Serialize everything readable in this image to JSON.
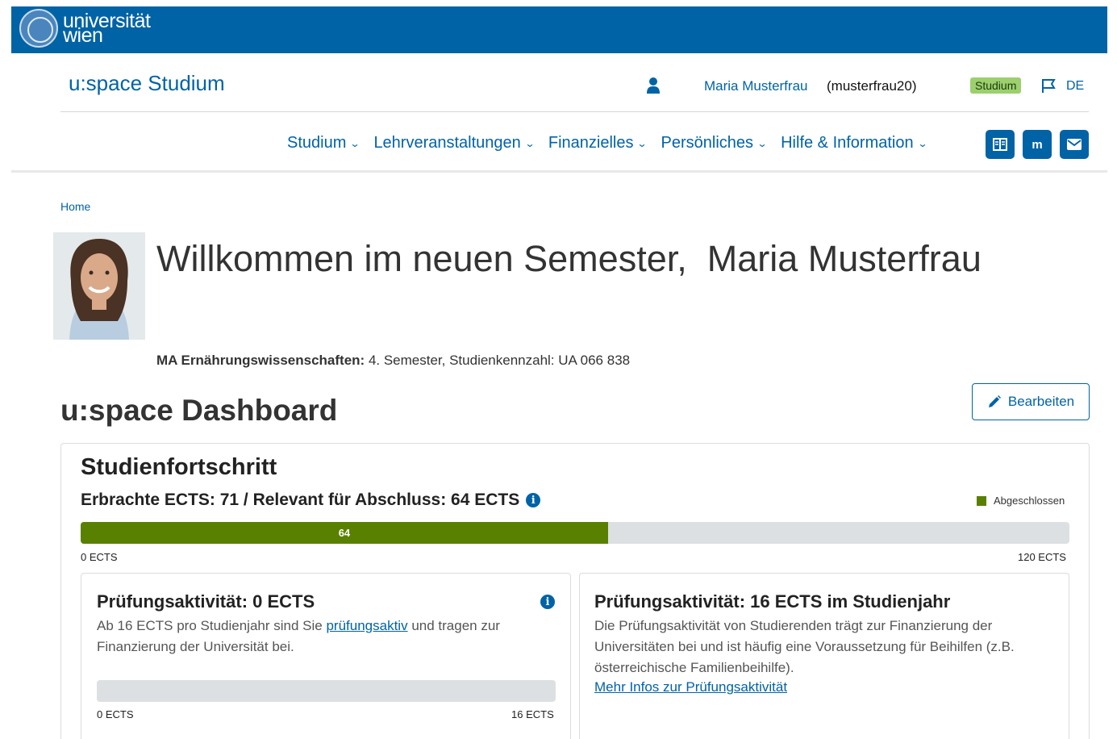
{
  "header": {
    "logo_line1": "universität",
    "logo_line2": "wien",
    "brand_color": "#0063a6"
  },
  "topline": {
    "title": "u:space Studium",
    "user_name": "Maria Musterfrau",
    "user_id": "(musterfrau20)",
    "badge": "Studium",
    "language": "DE"
  },
  "nav": {
    "items": [
      {
        "label": "Studium"
      },
      {
        "label": "Lehrveranstaltungen"
      },
      {
        "label": "Finanzielles"
      },
      {
        "label": "Persönliches"
      },
      {
        "label": "Hilfe & Information"
      }
    ],
    "icons": [
      "book-icon",
      "moodle-icon",
      "mail-icon"
    ]
  },
  "breadcrumb": "Home",
  "welcome": {
    "text": "Willkommen im neuen Semester,",
    "name": "Maria Musterfrau"
  },
  "study": {
    "program": "MA Ernährungswissenschaften:",
    "details": "4. Semester, Studienkennzahl: UA 066 838"
  },
  "dashboard": {
    "title": "u:space Dashboard",
    "edit_label": "Bearbeiten"
  },
  "progress": {
    "title": "Studienfortschritt",
    "ects_summary": "Erbrachte ECTS: 71 / Relevant für Abschluss: 64 ECTS",
    "legend": "Abgeschlossen",
    "value": 64,
    "max": 120,
    "value_label": "64",
    "axis_min": "0 ECTS",
    "axis_max": "120 ECTS",
    "fill_color": "#5a8000"
  },
  "activity_left": {
    "title": "Prüfungsaktivität: 0 ECTS",
    "text_before": "Ab 16 ECTS pro Studienjahr sind Sie",
    "link": "prüfungsaktiv",
    "text_after": "und tragen zur Finanzierung der Universität bei.",
    "value": 0,
    "max": 16,
    "axis_min": "0 ECTS",
    "axis_max": "16 ECTS"
  },
  "activity_right": {
    "title": "Prüfungsaktivität: 16 ECTS im Studienjahr",
    "text": "Die Prüfungsaktivität von Studierenden trägt zur Finanzierung der Universitäten bei und ist häufig eine Voraussetzung für Beihilfen (z.B. österreichische Familienbeihilfe).",
    "link": "Mehr Infos zur Prüfungsaktivität"
  }
}
